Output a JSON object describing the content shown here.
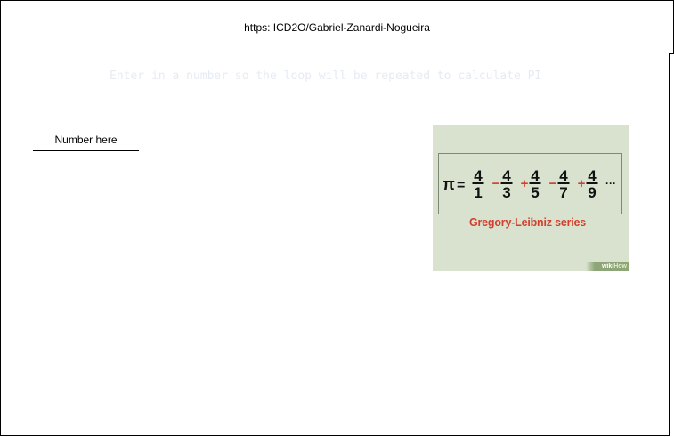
{
  "header": {
    "url_text": "https: ICD2O/Gabriel-Zanardi-Nogueira"
  },
  "main": {
    "instruction": "Enter in a number so the loop will be repeated to calculate PI",
    "number_input": {
      "placeholder": "Number here",
      "value": ""
    }
  },
  "formula_image": {
    "pi_symbol": "π",
    "equals": "=",
    "terms": [
      {
        "numerator": "4",
        "denominator": "1",
        "op": ""
      },
      {
        "numerator": "4",
        "denominator": "3",
        "op": "−"
      },
      {
        "numerator": "4",
        "denominator": "5",
        "op": "+"
      },
      {
        "numerator": "4",
        "denominator": "7",
        "op": "−"
      },
      {
        "numerator": "4",
        "denominator": "9",
        "op": "+"
      }
    ],
    "ellipsis": "···",
    "caption": "Gregory-Leibniz series",
    "brand_part1": "wiki",
    "brand_part2": "How",
    "colors": {
      "background": "#d9e2cf",
      "operator": "#d0402d",
      "caption": "#d0402d",
      "brand": "#8da577"
    }
  }
}
